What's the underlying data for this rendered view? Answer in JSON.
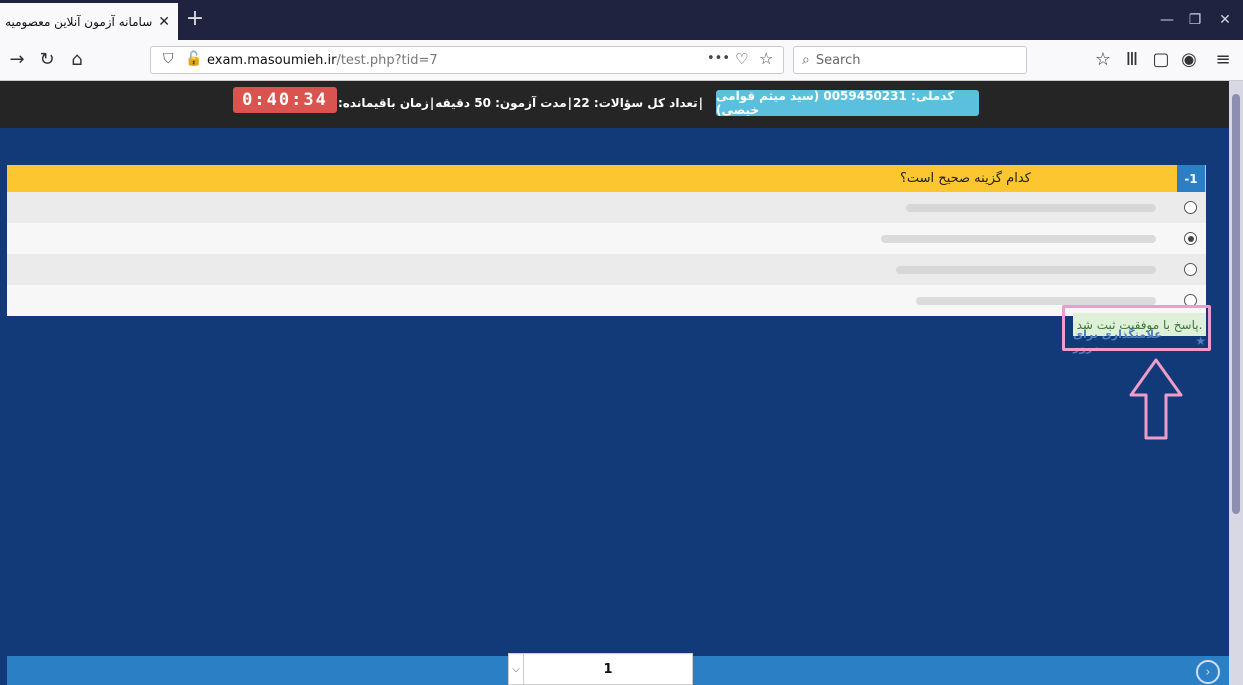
{
  "browser": {
    "tab_title": "سامانه آزمون آنلاین معصومیه",
    "tab_close": "✕",
    "new_tab": "+",
    "url_host": "exam.masoumieh.ir",
    "url_path": "/test.php?tid=7",
    "search_placeholder": "Search",
    "page_actions": "•••"
  },
  "header": {
    "student": "کدملی: 0059450231 (سید میثم قوامی خیصی)",
    "total_questions": "تعداد کل سؤالات: 22",
    "duration": "مدت آزمون: 50 دقیقه",
    "remaining_label": "زمان باقیمانده:",
    "separator": "|",
    "timer": "0:40:34"
  },
  "question": {
    "number": "-1",
    "text": "کدام گزینه صحیح است؟",
    "options": [
      {
        "selected": false
      },
      {
        "selected": true
      },
      {
        "selected": false
      },
      {
        "selected": false
      }
    ]
  },
  "feedback": {
    "success": "پاسخ با موفقیت ثبت شد.",
    "review_mark": "علامتگذاری برای مرور"
  },
  "pager": {
    "current_page": "1"
  },
  "colors": {
    "timer": "#d9534f",
    "badge": "#5bc0de",
    "question_bar": "#fcc630",
    "highlight": "#ef9ccb"
  }
}
